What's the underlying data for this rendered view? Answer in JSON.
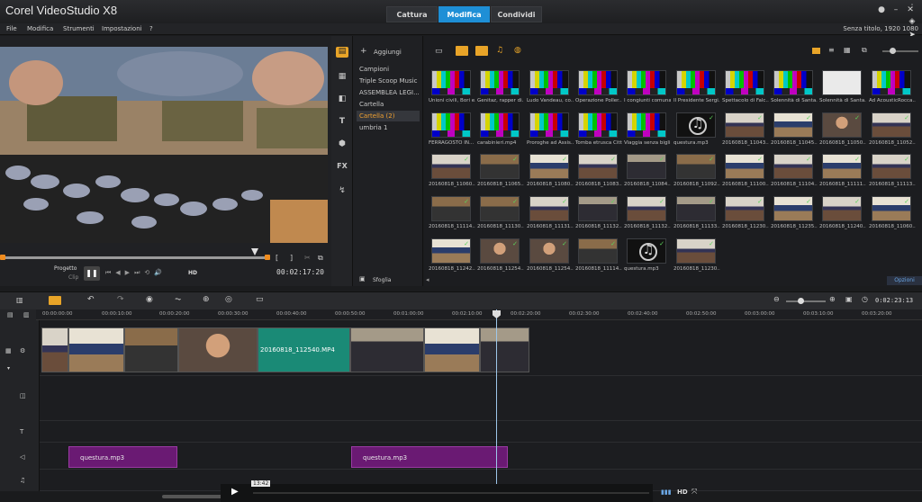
{
  "app": {
    "title": "Corel VideoStudio X8",
    "modes": [
      "Cattura",
      "Modifica",
      "Condividi"
    ],
    "active_mode": "Modifica",
    "project_info": "Senza titolo, 1920 1080"
  },
  "menu": [
    "File",
    "Modifica",
    "Strumenti",
    "Impostazioni",
    "?"
  ],
  "preview": {
    "project_label": "Progetto",
    "clip_label": "Clip",
    "hd_label": "HD",
    "timecode": "00:02:17:20"
  },
  "library": {
    "add_label": "Aggiungi",
    "browse_label": "Sfoglia",
    "options_label": "Opzioni",
    "folders": [
      "Campioni",
      "Triple Scoop Music",
      "ASSEMBLEA LEGI...",
      "Cartella",
      "Cartella (2)",
      "umbria 1"
    ],
    "selected_folder": "Cartella (2)",
    "items": [
      {
        "cap": "Unioni civili, Bori e...",
        "kind": "bars"
      },
      {
        "cap": "Genitaz, rapper di...",
        "kind": "bars"
      },
      {
        "cap": "Ludo Vandeau, co...",
        "kind": "bars"
      },
      {
        "cap": "Operazione Poller...",
        "kind": "bars"
      },
      {
        "cap": "I congiunti comuna...",
        "kind": "bars"
      },
      {
        "cap": "Il Presidente Sergi...",
        "kind": "bars"
      },
      {
        "cap": "Spettacolo di Falc...",
        "kind": "bars"
      },
      {
        "cap": "Solennità di Santa...",
        "kind": "bars"
      },
      {
        "cap": "Solennità di Santa...",
        "kind": "white"
      },
      {
        "cap": "Ad AcousticRocca...",
        "kind": "bars"
      },
      {
        "cap": "FERRAGOSTO IN...",
        "kind": "bars"
      },
      {
        "cap": "carabinieri.mp4",
        "kind": "bars"
      },
      {
        "cap": "Proroghe ad Assis...",
        "kind": "bars"
      },
      {
        "cap": "Tomba etrusca Citt...",
        "kind": "bars"
      },
      {
        "cap": "Viaggia senza bigli...",
        "kind": "bars"
      },
      {
        "cap": "questura.mp3",
        "kind": "audio"
      },
      {
        "cap": "20160818_11043...",
        "kind": "vid1"
      },
      {
        "cap": "20160818_11045...",
        "kind": "vid2"
      },
      {
        "cap": "20160818_11050...",
        "kind": "vid3"
      },
      {
        "cap": "20160818_11052...",
        "kind": "vid1"
      },
      {
        "cap": "20160818_11060...",
        "kind": "vid1"
      },
      {
        "cap": "20160818_11065...",
        "kind": "vid4"
      },
      {
        "cap": "20160818_11080...",
        "kind": "vid2"
      },
      {
        "cap": "20160818_11083...",
        "kind": "vid1"
      },
      {
        "cap": "20160818_11084...",
        "kind": "vid5"
      },
      {
        "cap": "20160818_11092...",
        "kind": "vid4"
      },
      {
        "cap": "20160818_11100...",
        "kind": "vid2"
      },
      {
        "cap": "20160818_11104...",
        "kind": "vid1"
      },
      {
        "cap": "20160818_11111...",
        "kind": "vid2"
      },
      {
        "cap": "20160818_11113...",
        "kind": "vid1"
      },
      {
        "cap": "20160818_11114...",
        "kind": "vid4"
      },
      {
        "cap": "20160818_11130...",
        "kind": "vid4"
      },
      {
        "cap": "20160818_11131...",
        "kind": "vid1"
      },
      {
        "cap": "20160818_11132...",
        "kind": "vid5"
      },
      {
        "cap": "20160818_11132...",
        "kind": "vid1"
      },
      {
        "cap": "20160818_11133...",
        "kind": "vid5"
      },
      {
        "cap": "20160818_11230...",
        "kind": "vid1"
      },
      {
        "cap": "20160818_11235...",
        "kind": "vid2"
      },
      {
        "cap": "20160818_11240...",
        "kind": "vid1"
      },
      {
        "cap": "20160818_11060...",
        "kind": "vid2"
      },
      {
        "cap": "20160818_11242...",
        "kind": "vid2"
      },
      {
        "cap": "20160818_11254...",
        "kind": "vid3"
      },
      {
        "cap": "20160818_11254...",
        "kind": "vid3"
      },
      {
        "cap": "20160818_11114...",
        "kind": "vid4"
      },
      {
        "cap": "questura.mp3",
        "kind": "audio"
      },
      {
        "cap": "20160818_11230...",
        "kind": "vid1"
      }
    ]
  },
  "timeline": {
    "total_time": "0:02:23:13",
    "ruler": [
      "00:00:00:00",
      "00:00:10:00",
      "00:00:20:00",
      "00:00:30:00",
      "00:00:40:00",
      "00:00:50:00",
      "00:01:00:00",
      "00:02:10:00",
      "00:02:20:00",
      "00:02:30:00",
      "00:02:40:00",
      "00:02:50:00",
      "00:03:00:00",
      "00:03:10:00",
      "00:03:20:00"
    ],
    "video_clip_label": "20160818_112540.MP4",
    "audio_clips": [
      "questura.mp3",
      "questura.mp3"
    ],
    "bubble_time": "13:42",
    "hd_label": "HD"
  }
}
